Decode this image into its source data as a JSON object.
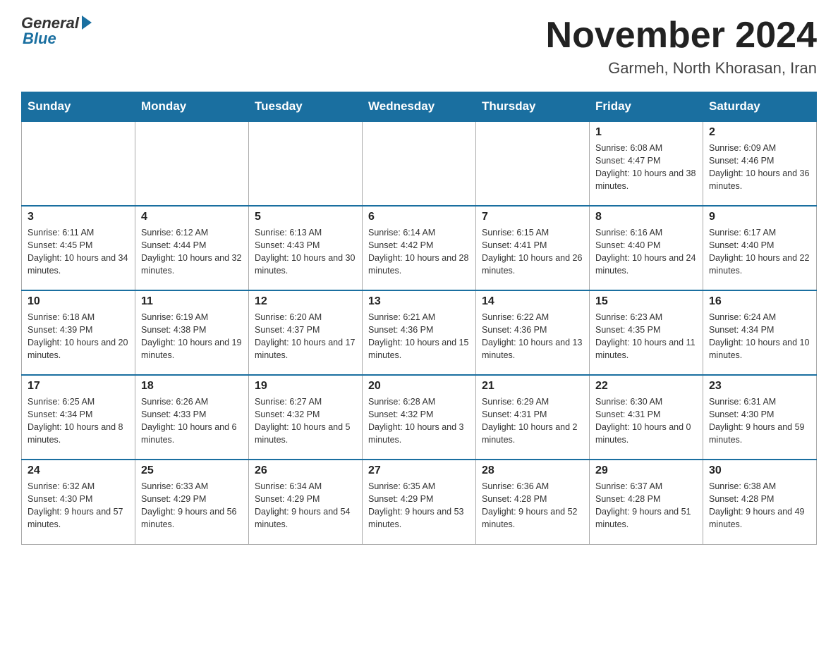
{
  "header": {
    "logo": {
      "general": "General",
      "blue": "Blue"
    },
    "title": "November 2024",
    "location": "Garmeh, North Khorasan, Iran"
  },
  "weekdays": [
    "Sunday",
    "Monday",
    "Tuesday",
    "Wednesday",
    "Thursday",
    "Friday",
    "Saturday"
  ],
  "weeks": [
    [
      {
        "day": "",
        "info": ""
      },
      {
        "day": "",
        "info": ""
      },
      {
        "day": "",
        "info": ""
      },
      {
        "day": "",
        "info": ""
      },
      {
        "day": "",
        "info": ""
      },
      {
        "day": "1",
        "info": "Sunrise: 6:08 AM\nSunset: 4:47 PM\nDaylight: 10 hours and 38 minutes."
      },
      {
        "day": "2",
        "info": "Sunrise: 6:09 AM\nSunset: 4:46 PM\nDaylight: 10 hours and 36 minutes."
      }
    ],
    [
      {
        "day": "3",
        "info": "Sunrise: 6:11 AM\nSunset: 4:45 PM\nDaylight: 10 hours and 34 minutes."
      },
      {
        "day": "4",
        "info": "Sunrise: 6:12 AM\nSunset: 4:44 PM\nDaylight: 10 hours and 32 minutes."
      },
      {
        "day": "5",
        "info": "Sunrise: 6:13 AM\nSunset: 4:43 PM\nDaylight: 10 hours and 30 minutes."
      },
      {
        "day": "6",
        "info": "Sunrise: 6:14 AM\nSunset: 4:42 PM\nDaylight: 10 hours and 28 minutes."
      },
      {
        "day": "7",
        "info": "Sunrise: 6:15 AM\nSunset: 4:41 PM\nDaylight: 10 hours and 26 minutes."
      },
      {
        "day": "8",
        "info": "Sunrise: 6:16 AM\nSunset: 4:40 PM\nDaylight: 10 hours and 24 minutes."
      },
      {
        "day": "9",
        "info": "Sunrise: 6:17 AM\nSunset: 4:40 PM\nDaylight: 10 hours and 22 minutes."
      }
    ],
    [
      {
        "day": "10",
        "info": "Sunrise: 6:18 AM\nSunset: 4:39 PM\nDaylight: 10 hours and 20 minutes."
      },
      {
        "day": "11",
        "info": "Sunrise: 6:19 AM\nSunset: 4:38 PM\nDaylight: 10 hours and 19 minutes."
      },
      {
        "day": "12",
        "info": "Sunrise: 6:20 AM\nSunset: 4:37 PM\nDaylight: 10 hours and 17 minutes."
      },
      {
        "day": "13",
        "info": "Sunrise: 6:21 AM\nSunset: 4:36 PM\nDaylight: 10 hours and 15 minutes."
      },
      {
        "day": "14",
        "info": "Sunrise: 6:22 AM\nSunset: 4:36 PM\nDaylight: 10 hours and 13 minutes."
      },
      {
        "day": "15",
        "info": "Sunrise: 6:23 AM\nSunset: 4:35 PM\nDaylight: 10 hours and 11 minutes."
      },
      {
        "day": "16",
        "info": "Sunrise: 6:24 AM\nSunset: 4:34 PM\nDaylight: 10 hours and 10 minutes."
      }
    ],
    [
      {
        "day": "17",
        "info": "Sunrise: 6:25 AM\nSunset: 4:34 PM\nDaylight: 10 hours and 8 minutes."
      },
      {
        "day": "18",
        "info": "Sunrise: 6:26 AM\nSunset: 4:33 PM\nDaylight: 10 hours and 6 minutes."
      },
      {
        "day": "19",
        "info": "Sunrise: 6:27 AM\nSunset: 4:32 PM\nDaylight: 10 hours and 5 minutes."
      },
      {
        "day": "20",
        "info": "Sunrise: 6:28 AM\nSunset: 4:32 PM\nDaylight: 10 hours and 3 minutes."
      },
      {
        "day": "21",
        "info": "Sunrise: 6:29 AM\nSunset: 4:31 PM\nDaylight: 10 hours and 2 minutes."
      },
      {
        "day": "22",
        "info": "Sunrise: 6:30 AM\nSunset: 4:31 PM\nDaylight: 10 hours and 0 minutes."
      },
      {
        "day": "23",
        "info": "Sunrise: 6:31 AM\nSunset: 4:30 PM\nDaylight: 9 hours and 59 minutes."
      }
    ],
    [
      {
        "day": "24",
        "info": "Sunrise: 6:32 AM\nSunset: 4:30 PM\nDaylight: 9 hours and 57 minutes."
      },
      {
        "day": "25",
        "info": "Sunrise: 6:33 AM\nSunset: 4:29 PM\nDaylight: 9 hours and 56 minutes."
      },
      {
        "day": "26",
        "info": "Sunrise: 6:34 AM\nSunset: 4:29 PM\nDaylight: 9 hours and 54 minutes."
      },
      {
        "day": "27",
        "info": "Sunrise: 6:35 AM\nSunset: 4:29 PM\nDaylight: 9 hours and 53 minutes."
      },
      {
        "day": "28",
        "info": "Sunrise: 6:36 AM\nSunset: 4:28 PM\nDaylight: 9 hours and 52 minutes."
      },
      {
        "day": "29",
        "info": "Sunrise: 6:37 AM\nSunset: 4:28 PM\nDaylight: 9 hours and 51 minutes."
      },
      {
        "day": "30",
        "info": "Sunrise: 6:38 AM\nSunset: 4:28 PM\nDaylight: 9 hours and 49 minutes."
      }
    ]
  ]
}
